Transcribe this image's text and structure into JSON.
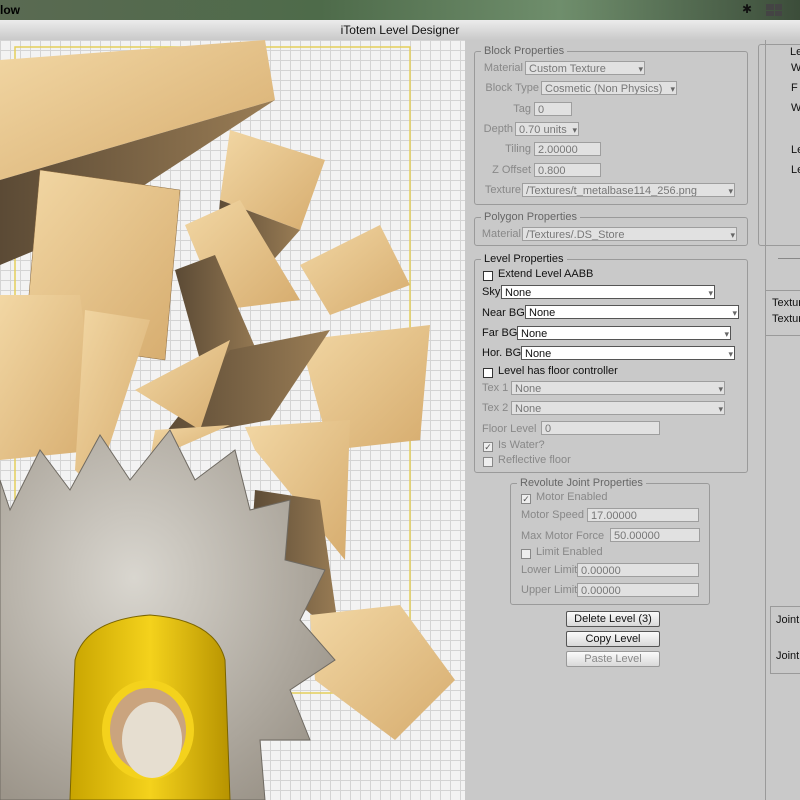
{
  "menubar": {
    "app_name": "low"
  },
  "window": {
    "title": "iTotem Level Designer"
  },
  "block_properties": {
    "legend": "Block Properties",
    "material_label": "Material",
    "material_value": "Custom Texture",
    "block_type_label": "Block Type",
    "block_type_value": "Cosmetic (Non Physics)",
    "tag_label": "Tag",
    "tag_value": "0",
    "depth_label": "Depth",
    "depth_value": "0.70 units",
    "tiling_label": "Tiling",
    "tiling_value": "2.00000",
    "zoffset_label": "Z Offset",
    "zoffset_value": "0.800",
    "texture_label": "Texture",
    "texture_value": "/Textures/t_metalbase114_256.png"
  },
  "polygon_properties": {
    "legend": "Polygon Properties",
    "material_label": "Material",
    "material_value": "/Textures/.DS_Store"
  },
  "level_properties": {
    "legend": "Level Properties",
    "extend_aabb_label": "Extend Level AABB",
    "sky_label": "Sky",
    "sky_value": "None",
    "near_bg_label": "Near BG",
    "near_bg_value": "None",
    "far_bg_label": "Far BG",
    "far_bg_value": "None",
    "hor_bg_label": "Hor. BG",
    "hor_bg_value": "None",
    "floor_controller_label": "Level has floor controller",
    "tex1_label": "Tex 1",
    "tex1_value": "None",
    "tex2_label": "Tex 2",
    "tex2_value": "None",
    "floor_level_label": "Floor Level",
    "floor_level_value": "0",
    "is_water_label": "Is Water?",
    "reflective_label": "Reflective floor"
  },
  "revolute_joint": {
    "legend": "Revolute Joint Properties",
    "motor_enabled_label": "Motor Enabled",
    "motor_speed_label": "Motor Speed",
    "motor_speed_value": "17.00000",
    "max_motor_force_label": "Max Motor Force",
    "max_motor_force_value": "50.00000",
    "limit_enabled_label": "Limit Enabled",
    "lower_limit_label": "Lower Limit",
    "lower_limit_value": "0.00000",
    "upper_limit_label": "Upper Limit",
    "upper_limit_value": "0.00000"
  },
  "buttons": {
    "delete_level": "Delete Level (3)",
    "copy_level": "Copy Level",
    "paste_level": "Paste Level"
  },
  "far_panel": {
    "legend_fragment": "Le",
    "labels": [
      "W",
      "F",
      "W",
      "Le",
      "Le"
    ],
    "texture_labels": [
      "Textur",
      "Textur"
    ],
    "joint_labels": [
      "Joint",
      "Joint"
    ]
  },
  "icons": [
    "bluetooth-icon",
    "spaces-icon",
    "dropdown-arrow-icon",
    "checkbox-icon"
  ]
}
